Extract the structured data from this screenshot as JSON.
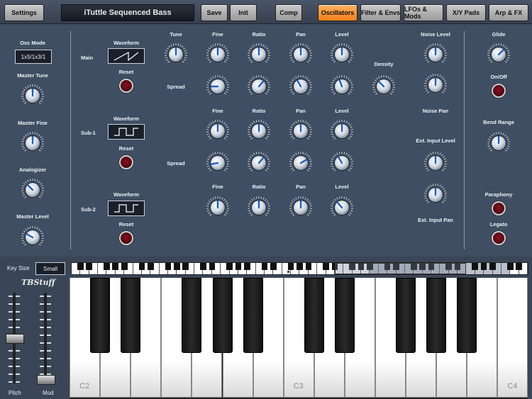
{
  "topbar": {
    "settings": "Settings",
    "preset": "iTuttle Sequenced Bass",
    "save": "Save",
    "init": "Init",
    "comp": "Comp",
    "tabs": [
      "Oscillators",
      "Filter & Envs",
      "LFOs & Mods",
      "X/Y Pads",
      "Arp & FX"
    ],
    "active_tab": "Oscillators",
    "accent": "#f58a24"
  },
  "left": {
    "osc_mode_label": "Osc Mode",
    "osc_mode_value": "1x5/1x3/1",
    "master_tune": "Master Tune",
    "master_fine": "Master Fine",
    "analogizer": "Analogizer",
    "master_level": "Master Level"
  },
  "osc": {
    "main": "Main",
    "sub1": "Sub-1",
    "sub2": "Sub-2",
    "waveform": "Waveform",
    "reset": "Reset",
    "tune": "Tune",
    "spread": "Spread",
    "fine": "Fine",
    "ratio": "Ratio",
    "pan": "Pan",
    "level": "Level",
    "density": "Density"
  },
  "noise": {
    "noise_level": "Noise Level",
    "noise_pan": "Noise Pan",
    "ext_input_level": "Ext. Input Level",
    "ext_input_pan": "Ext. Input Pan"
  },
  "right": {
    "glide": "Glide",
    "onoff": "On/Off",
    "bend_range": "Bend Range",
    "paraphony": "Paraphony",
    "legato": "Legato"
  },
  "keyboard": {
    "key_size_label": "Key Size",
    "key_size_value": "Small",
    "logo": "TBStuff",
    "notes": [
      "C2",
      "C3",
      "C4"
    ],
    "pitch": "Pitch",
    "mod": "Mod"
  }
}
